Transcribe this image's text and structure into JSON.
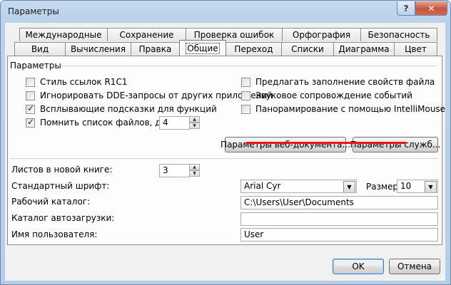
{
  "window": {
    "title": "Параметры"
  },
  "title_buttons": {
    "help": "?",
    "close": "✕"
  },
  "tabs": {
    "row_back": [
      "Международные",
      "Сохранение",
      "Проверка ошибок",
      "Орфография",
      "Безопасность"
    ],
    "row_front": [
      "Вид",
      "Вычисления",
      "Правка",
      "Общие",
      "Переход",
      "Списки",
      "Диаграмма",
      "Цвет"
    ],
    "active": "Общие"
  },
  "general": {
    "section_label": "Параметры",
    "options_left": [
      {
        "label": "Стиль ссылок R1C1",
        "checked": false
      },
      {
        "label": "Игнорировать DDE-запросы от других приложений",
        "checked": false
      },
      {
        "label": "Всплывающие подсказки для функций",
        "checked": true
      },
      {
        "label": "Помнить список файлов, до:",
        "checked": true
      }
    ],
    "recent_files_value": "4",
    "options_right": [
      {
        "label": "Предлагать заполнение свойств файла",
        "checked": false
      },
      {
        "label": "Звуковое сопровождение событий",
        "checked": false
      },
      {
        "label": "Панорамирование с помощью IntelliMouse",
        "checked": false
      }
    ],
    "web_options_button": "Параметры веб-документа...",
    "service_options_button": "Параметры служб...",
    "sheets_label": "Листов в новой книге:",
    "sheets_value": "3",
    "font_label": "Стандартный шрифт:",
    "font_value": "Arial Cyr",
    "size_label": "Размер:",
    "size_value": "10",
    "workdir_label": "Рабочий каталог:",
    "workdir_value": "C:\\Users\\User\\Documents",
    "startup_label": "Каталог автозагрузки:",
    "startup_value": "",
    "username_label": "Имя пользователя:",
    "username_value": "User"
  },
  "footer": {
    "ok": "OK",
    "cancel": "Отмена"
  },
  "colors": {
    "highlight_underline": "#e8171a",
    "default_button_border": "#3c7fb1"
  }
}
